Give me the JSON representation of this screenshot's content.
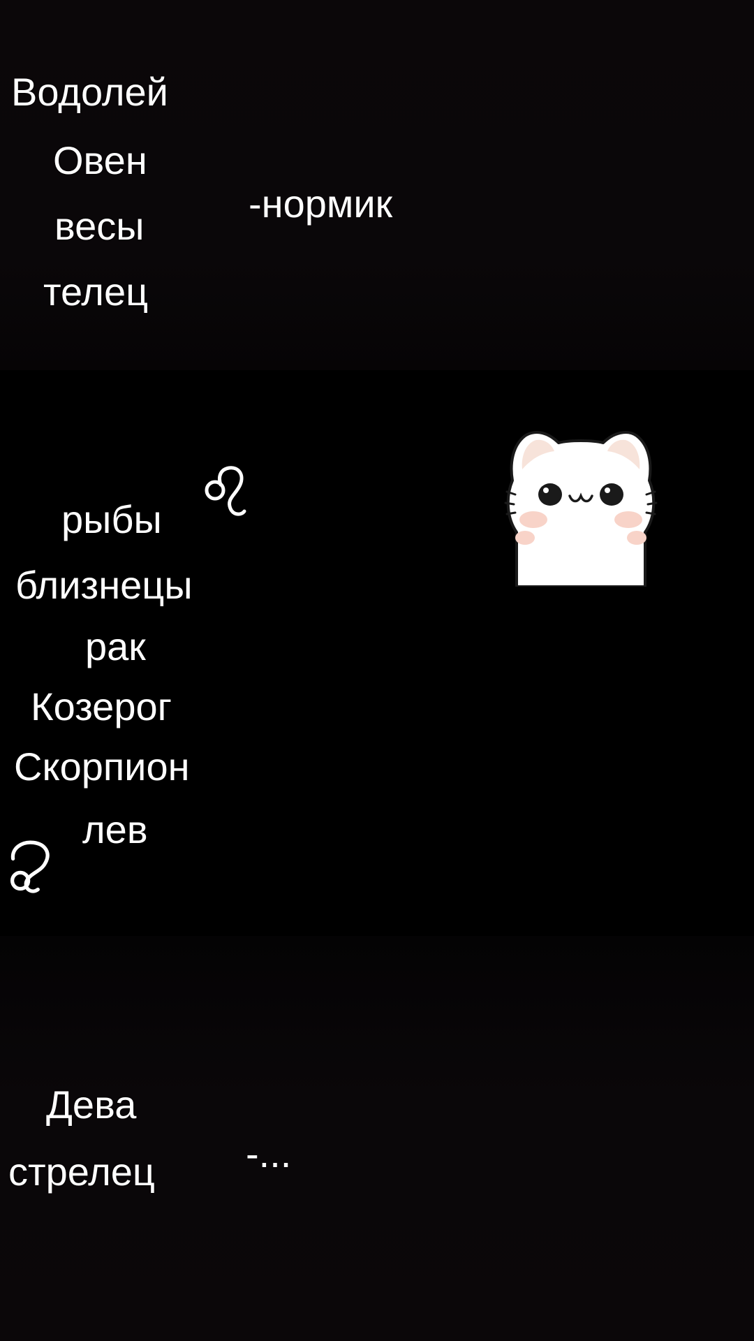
{
  "groups": {
    "group1": {
      "signs": [
        "Водолей",
        "Овен",
        "весы",
        "телец"
      ],
      "verdict": "-нормик"
    },
    "group2": {
      "signs": [
        "рыбы",
        "близнецы",
        "рак",
        "Козерог",
        "Скорпион",
        "лев"
      ]
    },
    "group3": {
      "signs": [
        "Дева",
        "стрелец"
      ],
      "verdict": "-..."
    }
  },
  "icons": {
    "leo_symbol": "leo-zodiac-icon",
    "sticker": "cat-sticker-icon"
  },
  "colors": {
    "background": "#000000",
    "text": "#ffffff",
    "cat_body": "#ffffff",
    "cat_ears": "#f7e3da",
    "cat_blush": "#f8d3c8"
  }
}
